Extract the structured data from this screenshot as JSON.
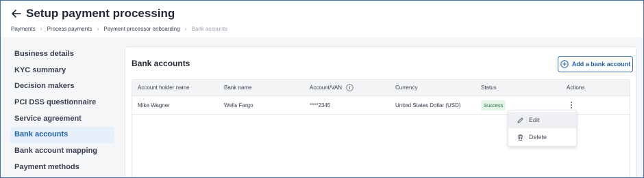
{
  "header": {
    "title": "Setup payment processing",
    "breadcrumbs": [
      "Payments",
      "Process payments",
      "Payment processor onboarding",
      "Bank accounts"
    ]
  },
  "sidebar": {
    "items": [
      {
        "label": "Business details"
      },
      {
        "label": "KYC summary"
      },
      {
        "label": "Decision makers"
      },
      {
        "label": "PCI DSS questionnaire"
      },
      {
        "label": "Service agreement"
      },
      {
        "label": "Bank accounts",
        "active": true
      },
      {
        "label": "Bank account mapping"
      },
      {
        "label": "Payment methods"
      }
    ]
  },
  "main": {
    "title": "Bank accounts",
    "add_button": "Add a bank account",
    "table": {
      "columns": [
        "Account holder name",
        "Bank name",
        "Account/VAN",
        "Currency",
        "Status",
        "Actions"
      ],
      "rows": [
        {
          "holder": "Mike Wagner",
          "bank": "Wells Fargo",
          "account": "****2345",
          "currency": "United States Dollar (USD)",
          "status": "Success"
        }
      ]
    },
    "actions_menu": {
      "edit": "Edit",
      "delete": "Delete"
    }
  },
  "colors": {
    "accent": "#1d5fa8",
    "success_bg": "#e3f6e8",
    "success_text": "#1e7a3a",
    "active_bg": "#e6f0fb"
  }
}
